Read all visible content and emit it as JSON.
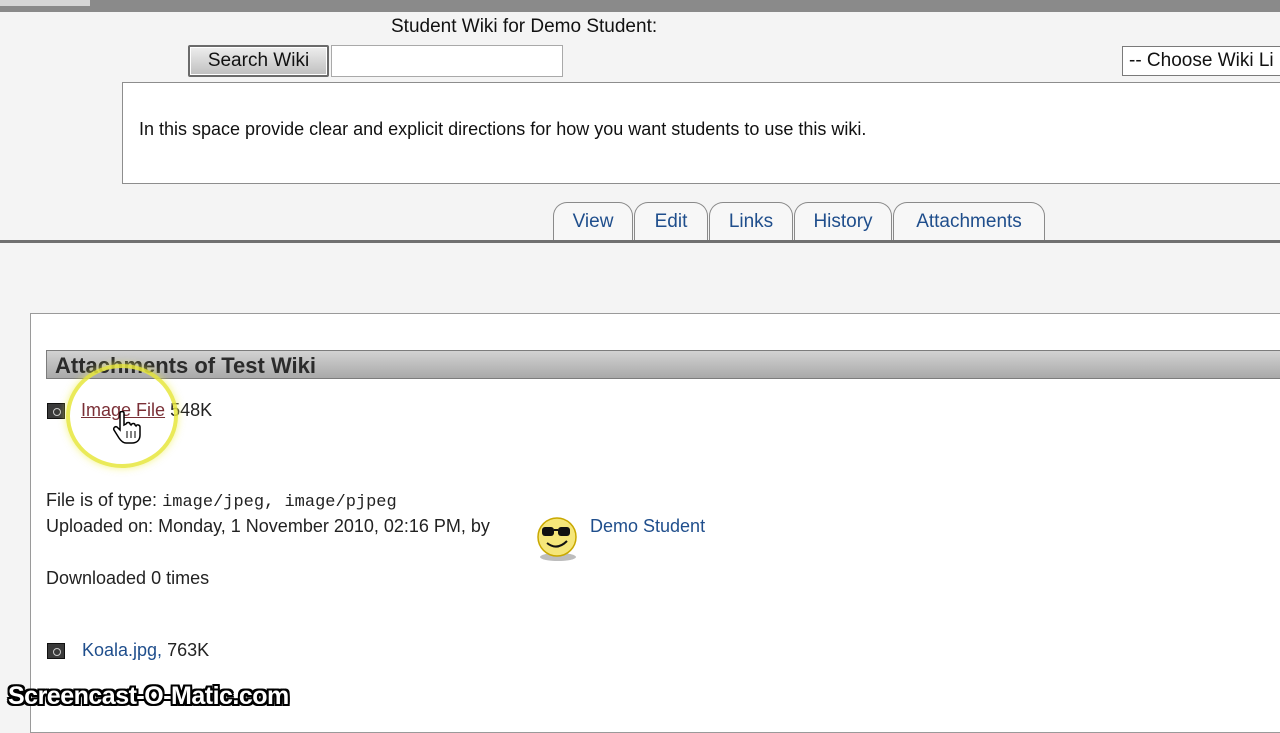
{
  "wiki": {
    "heading": "Student Wiki for Demo Student:",
    "search_button": "Search Wiki",
    "search_value": "",
    "choose_link_select": "-- Choose Wiki Li",
    "directions": "In this space provide clear and explicit directions for how you want students to use this wiki."
  },
  "tabs": [
    {
      "label": "View"
    },
    {
      "label": "Edit"
    },
    {
      "label": "Links"
    },
    {
      "label": "History"
    },
    {
      "label": "Attachments"
    }
  ],
  "attachments": {
    "title": "Attachments of Test Wiki",
    "items": [
      {
        "name": "Image File",
        "size": "548K"
      },
      {
        "name": "Koala.jpg,",
        "size": "763K"
      }
    ],
    "details": {
      "type_label": "File is of type:",
      "type_value": "image/jpeg, image/pjpeg",
      "uploaded": "Uploaded on: Monday, 1 November 2010, 02:16 PM, by",
      "uploader": "Demo Student",
      "downloaded": "Downloaded 0 times"
    }
  },
  "watermark": "Screencast-O-Matic.com",
  "icons": {
    "file": "file-icon",
    "avatar": "smiley-avatar-icon",
    "cursor": "hand-pointer-icon"
  },
  "colors": {
    "link": "#1f4e8c",
    "visited_link": "#7a2f36",
    "highlight": "#e6e63c"
  }
}
